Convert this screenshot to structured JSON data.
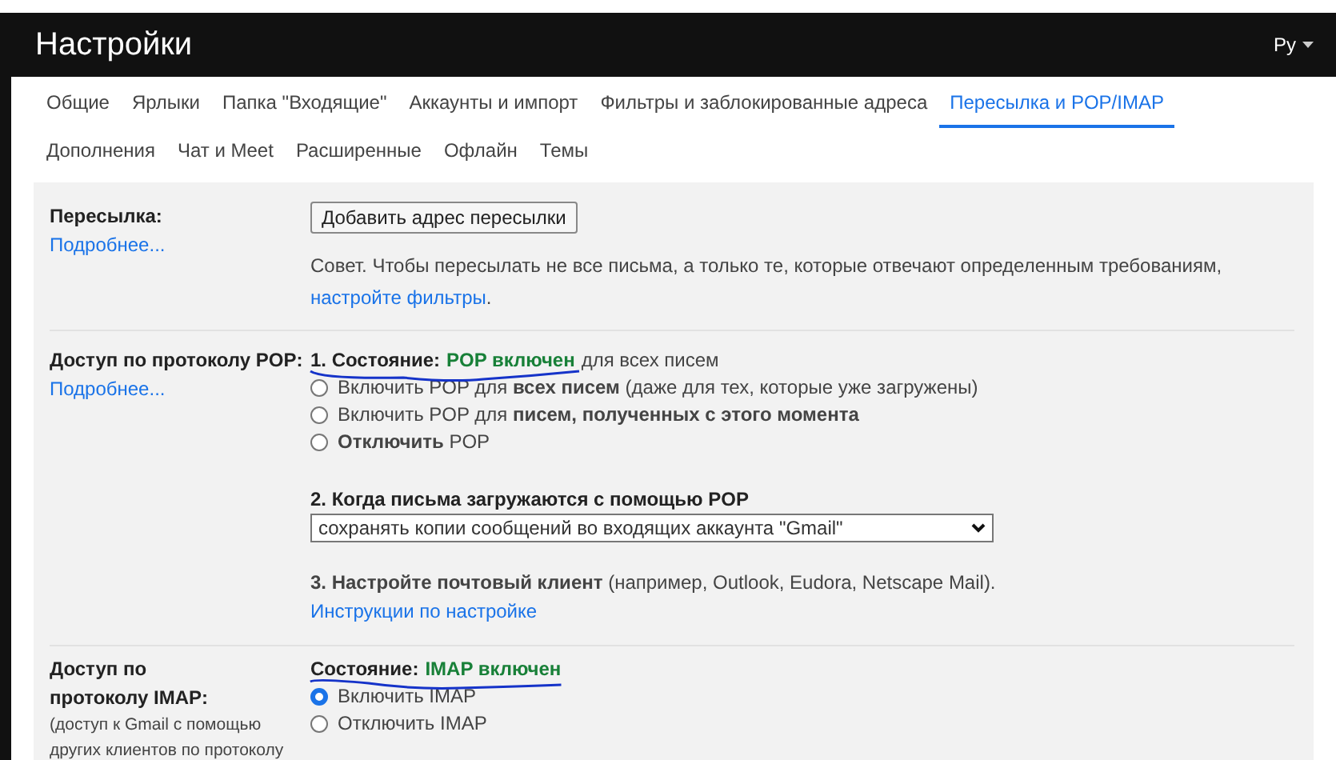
{
  "header": {
    "title": "Настройки",
    "account": "Рy"
  },
  "tab_rows": [
    [
      {
        "label": "Общие",
        "selected": false
      },
      {
        "label": "Ярлыки",
        "selected": false
      },
      {
        "label": "Папка \"Входящие\"",
        "selected": false
      },
      {
        "label": "Аккаунты и импорт",
        "selected": false
      },
      {
        "label": "Фильтры и заблокированные адреса",
        "selected": false
      },
      {
        "label": "Пересылка и POP/IMAP",
        "selected": true
      }
    ],
    [
      {
        "label": "Дополнения",
        "selected": false
      },
      {
        "label": "Чат и Meet",
        "selected": false
      },
      {
        "label": "Расширенные",
        "selected": false
      },
      {
        "label": "Офлайн",
        "selected": false
      },
      {
        "label": "Темы",
        "selected": false
      }
    ]
  ],
  "forwarding": {
    "label": "Пересылка:",
    "link": "Подробнее...",
    "button": "Добавить адрес пересылки",
    "tip": "Совет. Чтобы пересылать не все письма, а только те, которые отвечают определенным требованиям,",
    "tip_link": "настройте фильтры",
    "tip_end": "."
  },
  "pop": {
    "label": "Доступ по протоколу POP:",
    "link": "Подробнее...",
    "status_prefix": "1. Состояние:",
    "status_value": "POP включен",
    "status_suffix": "для всех писем",
    "options": [
      {
        "text": "Включить POP для **всех писем** (даже для тех, которые уже загружены)",
        "selected": false
      },
      {
        "text": "Включить POP для **писем, полученных с этого момента**",
        "selected": false
      },
      {
        "text": "**Отключить** POP",
        "selected": false
      }
    ],
    "step2": "2. Когда письма загружаются с помощью POP",
    "select_value": "сохранять копии сообщений во входящих аккаунта \"Gmail\"",
    "step3": "**3. Настройте почтовый клиент** (например, Outlook, Eudora, Netscape Mail).",
    "step3_link": "Инструкции по настройке"
  },
  "imap": {
    "label": "Доступ по протоколу IMAP:",
    "note": "(доступ к Gmail с помощью других клиентов по протоколу",
    "status_prefix": "Состояние:",
    "status_value": "IMAP включен",
    "options": [
      {
        "text": "Включить IMAP",
        "selected": true
      },
      {
        "text": "Отключить IMAP",
        "selected": false
      }
    ]
  }
}
